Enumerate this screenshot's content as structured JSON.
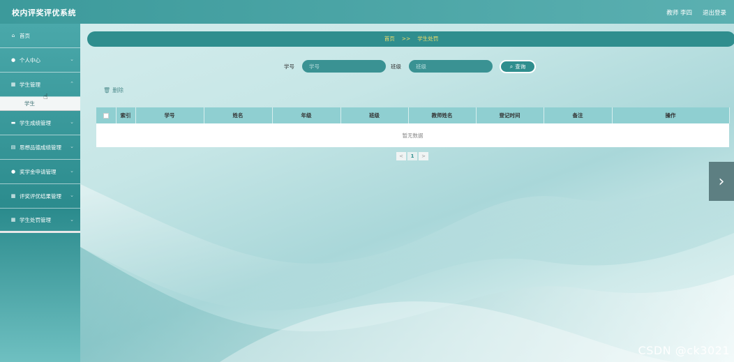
{
  "header": {
    "app_title": "校内评奖评优系统",
    "user_info": "教师 李四",
    "logout_label": "退出登录"
  },
  "sidebar": {
    "items": [
      {
        "label": "首页",
        "icon": "home-icon"
      },
      {
        "label": "个人中心",
        "icon": "user-icon"
      },
      {
        "label": "学生管理",
        "icon": "grid-icon",
        "submenu": [
          "学生"
        ]
      },
      {
        "label": "学生成绩管理",
        "icon": "chat-icon"
      },
      {
        "label": "思想品德成绩管理",
        "icon": "clipboard-icon"
      },
      {
        "label": "奖学金申请管理",
        "icon": "user-icon"
      },
      {
        "label": "评奖评优结果管理",
        "icon": "grid-icon"
      },
      {
        "label": "学生处罚管理",
        "icon": "grid-icon"
      }
    ]
  },
  "breadcrumb": {
    "home": "首页",
    "separator": ">>",
    "current": "学生处罚"
  },
  "search": {
    "student_id_label": "学号",
    "student_id_placeholder": "学号",
    "class_label": "班级",
    "class_placeholder": "班级",
    "query_label": "查询"
  },
  "toolbar": {
    "delete_label": "删除"
  },
  "table": {
    "columns": [
      "索引",
      "学号",
      "姓名",
      "年级",
      "班级",
      "教师姓名",
      "登记时间",
      "备注",
      "操作"
    ],
    "empty_text": "暂无数据"
  },
  "pagination": {
    "current_page": "1",
    "prev": "<",
    "next": ">"
  },
  "colors": {
    "accent": "#2f8e8e",
    "breadcrumb_text": "#f3df6a",
    "table_header": "#8fcfd1"
  },
  "watermark": "CSDN @ck3021"
}
